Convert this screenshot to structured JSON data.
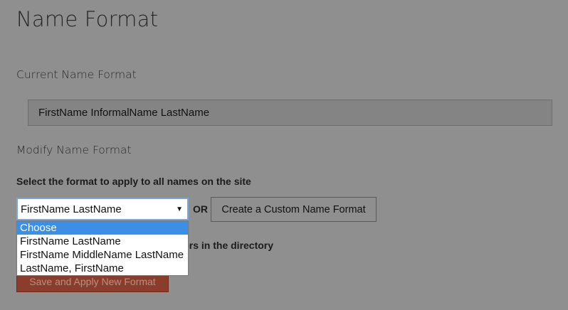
{
  "page": {
    "title": "Name Format"
  },
  "current": {
    "heading": "Current Name Format",
    "value": "FirstName InformalName LastName"
  },
  "modify": {
    "heading": "Modify Name Format",
    "instruction": "Select the format to apply to all names on the site",
    "select": {
      "selected": "FirstName LastName",
      "arrow": "▼",
      "options": [
        "Choose",
        "FirstName LastName",
        "FirstName MiddleName LastName",
        "LastName, FirstName"
      ],
      "highlighted_index": 0
    },
    "or_label": "OR",
    "custom_button_label": "Create a Custom Name Format",
    "apply_label_visible_fragment": "ers in the directory",
    "save_button_label": "Save and Apply New Format"
  },
  "colors": {
    "overlay_background": "#8f8f8f",
    "select_focus_border": "#7aa7d6",
    "option_highlight": "#3b8fe6",
    "save_button_bg": "#8a3d2a"
  }
}
